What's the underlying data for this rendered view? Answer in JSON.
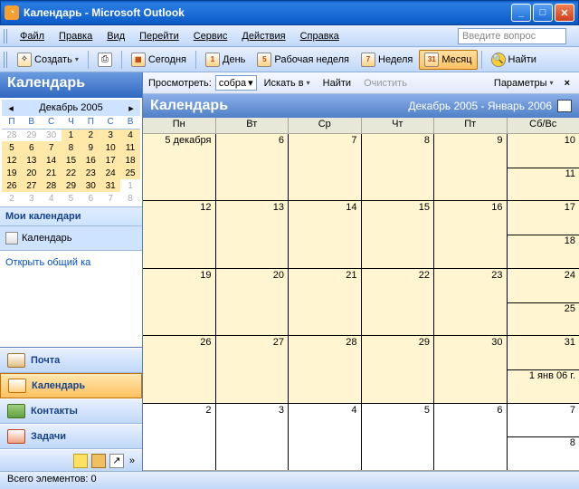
{
  "window": {
    "title": "Календарь - Microsoft Outlook"
  },
  "menu": {
    "file": "Файл",
    "edit": "Правка",
    "view": "Вид",
    "go": "Перейти",
    "tools": "Сервис",
    "actions": "Действия",
    "help": "Справка",
    "help_placeholder": "Введите вопрос"
  },
  "toolbar": {
    "create": "Создать",
    "today": "Сегодня",
    "day": "День",
    "workweek": "Рабочая неделя",
    "week": "Неделя",
    "month": "Месяц",
    "find": "Найти",
    "d1": "1",
    "d5": "5",
    "d7": "7",
    "d31": "31"
  },
  "sidebar": {
    "title": "Календарь",
    "minical_month": "Декабрь 2005",
    "dow": [
      "П",
      "В",
      "С",
      "Ч",
      "П",
      "С",
      "В"
    ],
    "rows": [
      [
        "28",
        "29",
        "30",
        "1",
        "2",
        "3",
        "4"
      ],
      [
        "5",
        "6",
        "7",
        "8",
        "9",
        "10",
        "11"
      ],
      [
        "12",
        "13",
        "14",
        "15",
        "16",
        "17",
        "18"
      ],
      [
        "19",
        "20",
        "21",
        "22",
        "23",
        "24",
        "25"
      ],
      [
        "26",
        "27",
        "28",
        "29",
        "30",
        "31",
        "1"
      ],
      [
        "2",
        "3",
        "4",
        "5",
        "6",
        "7",
        "8"
      ]
    ],
    "mycal": "Мои календари",
    "cal_item": "Календарь",
    "open_shared": "Открыть общий ка",
    "nav": {
      "mail": "Почта",
      "calendar": "Календарь",
      "contacts": "Контакты",
      "tasks": "Задачи"
    }
  },
  "filter": {
    "view": "Просмотреть:",
    "sobra": "собра",
    "search_in": "Искать в",
    "find": "Найти",
    "clear": "Очистить",
    "params": "Параметры"
  },
  "calmain": {
    "title": "Календарь",
    "range": "Декабрь 2005 - Январь 2006",
    "dow": [
      "Пн",
      "Вт",
      "Ср",
      "Чт",
      "Пт",
      "Сб/Вс"
    ],
    "cells": [
      [
        {
          "t": "5 декабря",
          "r": 1
        },
        {
          "t": "6",
          "r": 1
        },
        {
          "t": "7",
          "r": 1
        },
        {
          "t": "8",
          "r": 1
        },
        {
          "t": "9",
          "r": 1
        },
        {
          "t": "10",
          "b": "11",
          "r": 1
        }
      ],
      [
        {
          "t": "12",
          "r": 1
        },
        {
          "t": "13",
          "r": 1
        },
        {
          "t": "14",
          "r": 1
        },
        {
          "t": "15",
          "r": 1
        },
        {
          "t": "16",
          "r": 1
        },
        {
          "t": "17",
          "b": "18",
          "r": 1
        }
      ],
      [
        {
          "t": "19",
          "r": 1
        },
        {
          "t": "20",
          "r": 1
        },
        {
          "t": "21",
          "r": 1
        },
        {
          "t": "22",
          "r": 1
        },
        {
          "t": "23",
          "r": 1
        },
        {
          "t": "24",
          "b": "25",
          "r": 1
        }
      ],
      [
        {
          "t": "26",
          "r": 1
        },
        {
          "t": "27",
          "r": 1
        },
        {
          "t": "28",
          "r": 1
        },
        {
          "t": "29",
          "r": 1
        },
        {
          "t": "30",
          "r": 1
        },
        {
          "t": "31",
          "b": "1 янв 06 г.",
          "r": 1
        }
      ],
      [
        {
          "t": "2"
        },
        {
          "t": "3"
        },
        {
          "t": "4"
        },
        {
          "t": "5"
        },
        {
          "t": "6"
        },
        {
          "t": "7",
          "b": "8"
        }
      ]
    ]
  },
  "status": "Всего элементов: 0"
}
